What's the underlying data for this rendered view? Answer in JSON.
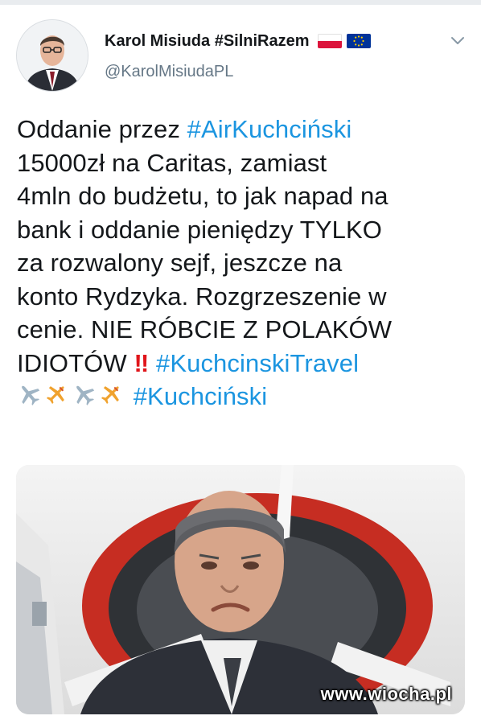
{
  "tweet": {
    "author_name": "Karol Misiuda #SilniRazem",
    "handle": "@KarolMisiudaPL",
    "lines": [
      [
        {
          "t": "Oddanie przez ",
          "k": "text"
        },
        {
          "t": "#AirKuchciński",
          "k": "hashtag"
        }
      ],
      [
        {
          "t": "15000zł na Caritas, zamiast",
          "k": "text"
        }
      ],
      [
        {
          "t": "4mln do budżetu, to jak napad na",
          "k": "text"
        }
      ],
      [
        {
          "t": "bank i oddanie pieniędzy TYLKO",
          "k": "text"
        }
      ],
      [
        {
          "t": "za rozwalony sejf, jeszcze na",
          "k": "text"
        }
      ],
      [
        {
          "t": "konto Rydzyka. Rozgrzeszenie w",
          "k": "text"
        }
      ],
      [
        {
          "t": "cenie. NIE RÓBCIE Z POLAKÓW",
          "k": "text"
        }
      ],
      [
        {
          "t": "IDIOTÓW ",
          "k": "text"
        },
        {
          "t": "‼",
          "k": "bang"
        },
        {
          "t": " ",
          "k": "text"
        },
        {
          "t": "#KuchcinskiTravel",
          "k": "hashtag"
        }
      ],
      [
        {
          "t": "",
          "k": "planes"
        },
        {
          "t": " ",
          "k": "text"
        },
        {
          "t": "#Kuchciński",
          "k": "hashtag"
        }
      ]
    ]
  },
  "icons": {
    "avatar": "profile-photo",
    "flags": [
      "poland-flag-icon",
      "eu-flag-icon"
    ],
    "menu": "chevron-down-icon",
    "emoji": [
      "airplane-icon",
      "small-airplane-icon",
      "airplane-icon",
      "small-airplane-icon"
    ]
  },
  "media": {
    "watermark": "www.wiocha.pl"
  },
  "colors": {
    "hashtag": "#1b95e0",
    "text": "#14171a",
    "secondary": "#657786",
    "bang": "#e0151b"
  }
}
